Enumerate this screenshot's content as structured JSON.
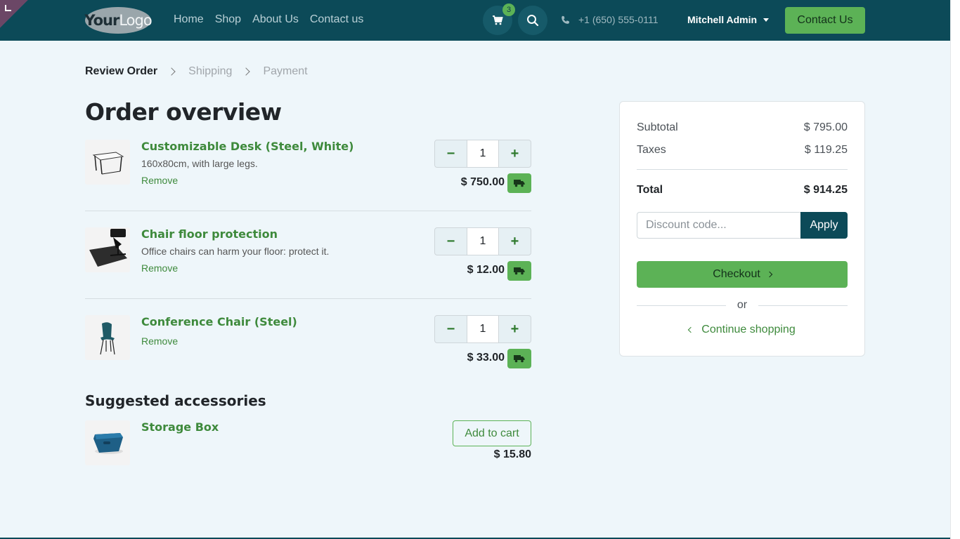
{
  "header": {
    "logo_your": "Your",
    "logo_logo": "Logo",
    "nav": [
      "Home",
      "Shop",
      "About Us",
      "Contact us"
    ],
    "cart_count": "3",
    "phone": "+1 (650) 555-0111",
    "user": "Mitchell Admin",
    "contact_button": "Contact Us"
  },
  "steps": [
    "Review Order",
    "Shipping",
    "Payment"
  ],
  "title": "Order overview",
  "lines": [
    {
      "name": "Customizable Desk (Steel, White)",
      "desc": "160x80cm, with large legs.",
      "remove": "Remove",
      "qty": "1",
      "price": "$ 750.00",
      "image": "desk-image"
    },
    {
      "name": "Chair floor protection",
      "desc": "Office chairs can harm your floor: protect it.",
      "remove": "Remove",
      "qty": "1",
      "price": "$ 12.00",
      "image": "floor-mat-image"
    },
    {
      "name": "Conference Chair (Steel)",
      "desc": "",
      "remove": "Remove",
      "qty": "1",
      "price": "$ 33.00",
      "image": "chair-image"
    }
  ],
  "suggested": {
    "heading": "Suggested accessories",
    "items": [
      {
        "name": "Storage Box",
        "price": "$ 15.80",
        "button": "Add to cart",
        "image": "storage-box-image"
      }
    ]
  },
  "summary": {
    "subtotal_label": "Subtotal",
    "subtotal": "$ 795.00",
    "taxes_label": "Taxes",
    "taxes": "$ 119.25",
    "total_label": "Total",
    "total": "$ 914.25",
    "discount_placeholder": "Discount code...",
    "apply": "Apply",
    "checkout": "Checkout",
    "or": "or",
    "continue": "Continue shopping"
  },
  "colors": {
    "header_bg": "#0c4a58",
    "accent_green": "#5cb256",
    "link_green": "#3e8a3c",
    "page_bg": "#eef6fa"
  }
}
